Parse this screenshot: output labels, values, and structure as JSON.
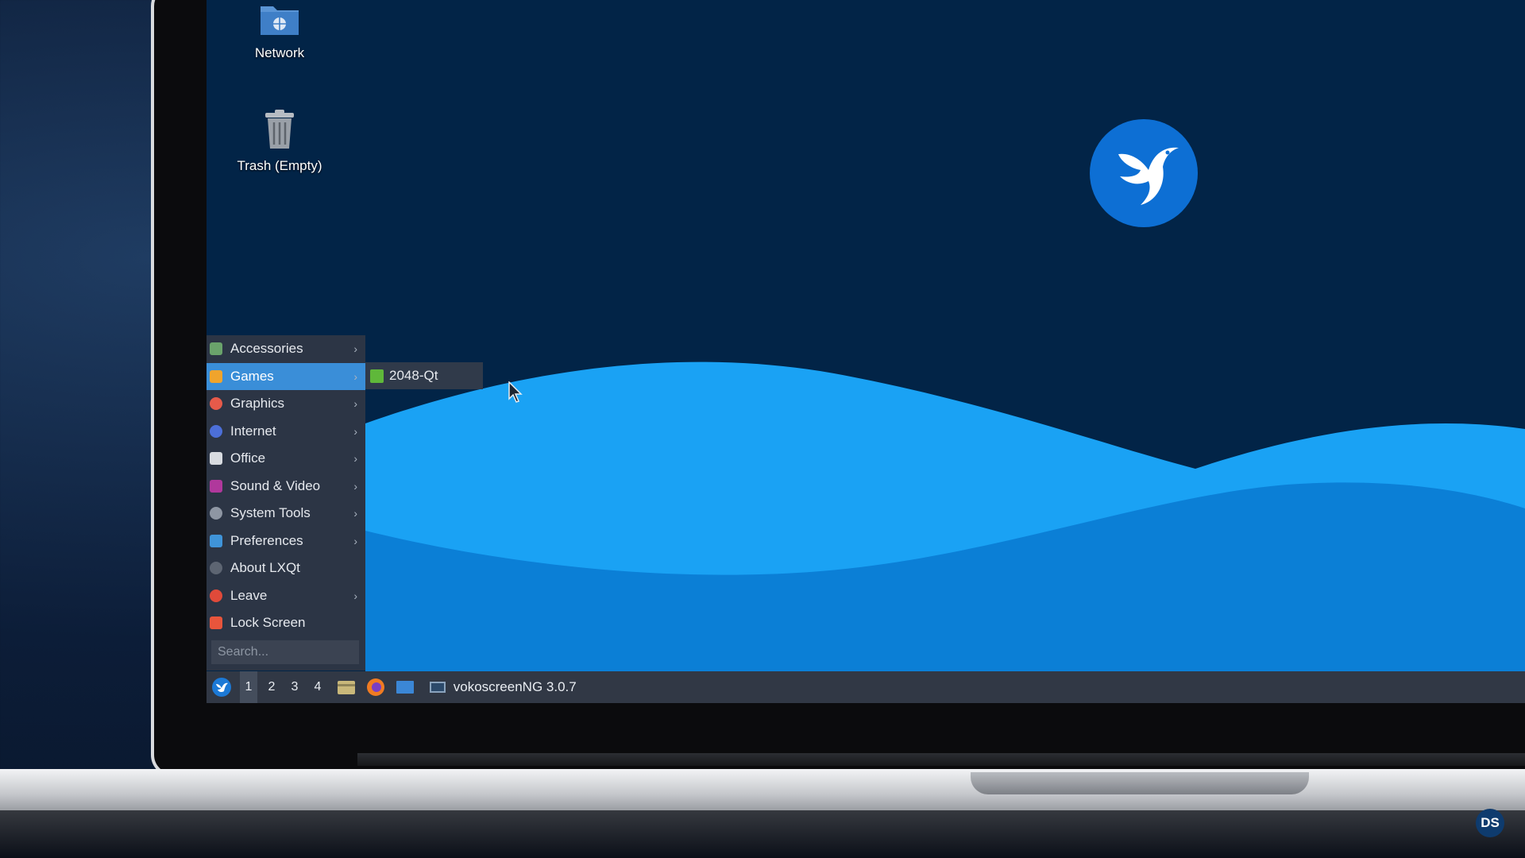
{
  "desktop": {
    "icons": [
      {
        "label": "Network",
        "icon": "network-folder-icon"
      },
      {
        "label": "Trash (Empty)",
        "icon": "trash-icon"
      }
    ],
    "logo": "lubuntu-bird-logo",
    "colors": {
      "wallpaper": "#022447",
      "wave_light": "#1aa2f4",
      "wave_dark": "#0b7fd6"
    }
  },
  "menu": {
    "items": [
      {
        "label": "Accessories",
        "icon": "accessories-icon",
        "has_submenu": true
      },
      {
        "label": "Games",
        "icon": "games-icon",
        "has_submenu": true,
        "active": true
      },
      {
        "label": "Graphics",
        "icon": "graphics-icon",
        "has_submenu": true
      },
      {
        "label": "Internet",
        "icon": "internet-icon",
        "has_submenu": true
      },
      {
        "label": "Office",
        "icon": "office-icon",
        "has_submenu": true
      },
      {
        "label": "Sound & Video",
        "icon": "sound-video-icon",
        "has_submenu": true
      },
      {
        "label": "System Tools",
        "icon": "system-tools-icon",
        "has_submenu": true
      },
      {
        "label": "Preferences",
        "icon": "preferences-icon",
        "has_submenu": true
      },
      {
        "label": "About LXQt",
        "icon": "info-icon",
        "has_submenu": false
      },
      {
        "label": "Leave",
        "icon": "power-icon",
        "has_submenu": true
      },
      {
        "label": "Lock Screen",
        "icon": "lock-icon",
        "has_submenu": false
      }
    ],
    "search_placeholder": "Search...",
    "submenu": {
      "items": [
        {
          "label": "2048-Qt",
          "icon": "2048-icon"
        }
      ]
    }
  },
  "taskbar": {
    "workspaces": [
      "1",
      "2",
      "3",
      "4"
    ],
    "active_workspace": "1",
    "quicklaunch": [
      "file-manager-icon",
      "firefox-icon",
      "desktop-icon"
    ],
    "task": {
      "label": "vokoscreenNG 3.0.7",
      "icon": "vokoscreen-icon"
    }
  },
  "badge": "DS"
}
